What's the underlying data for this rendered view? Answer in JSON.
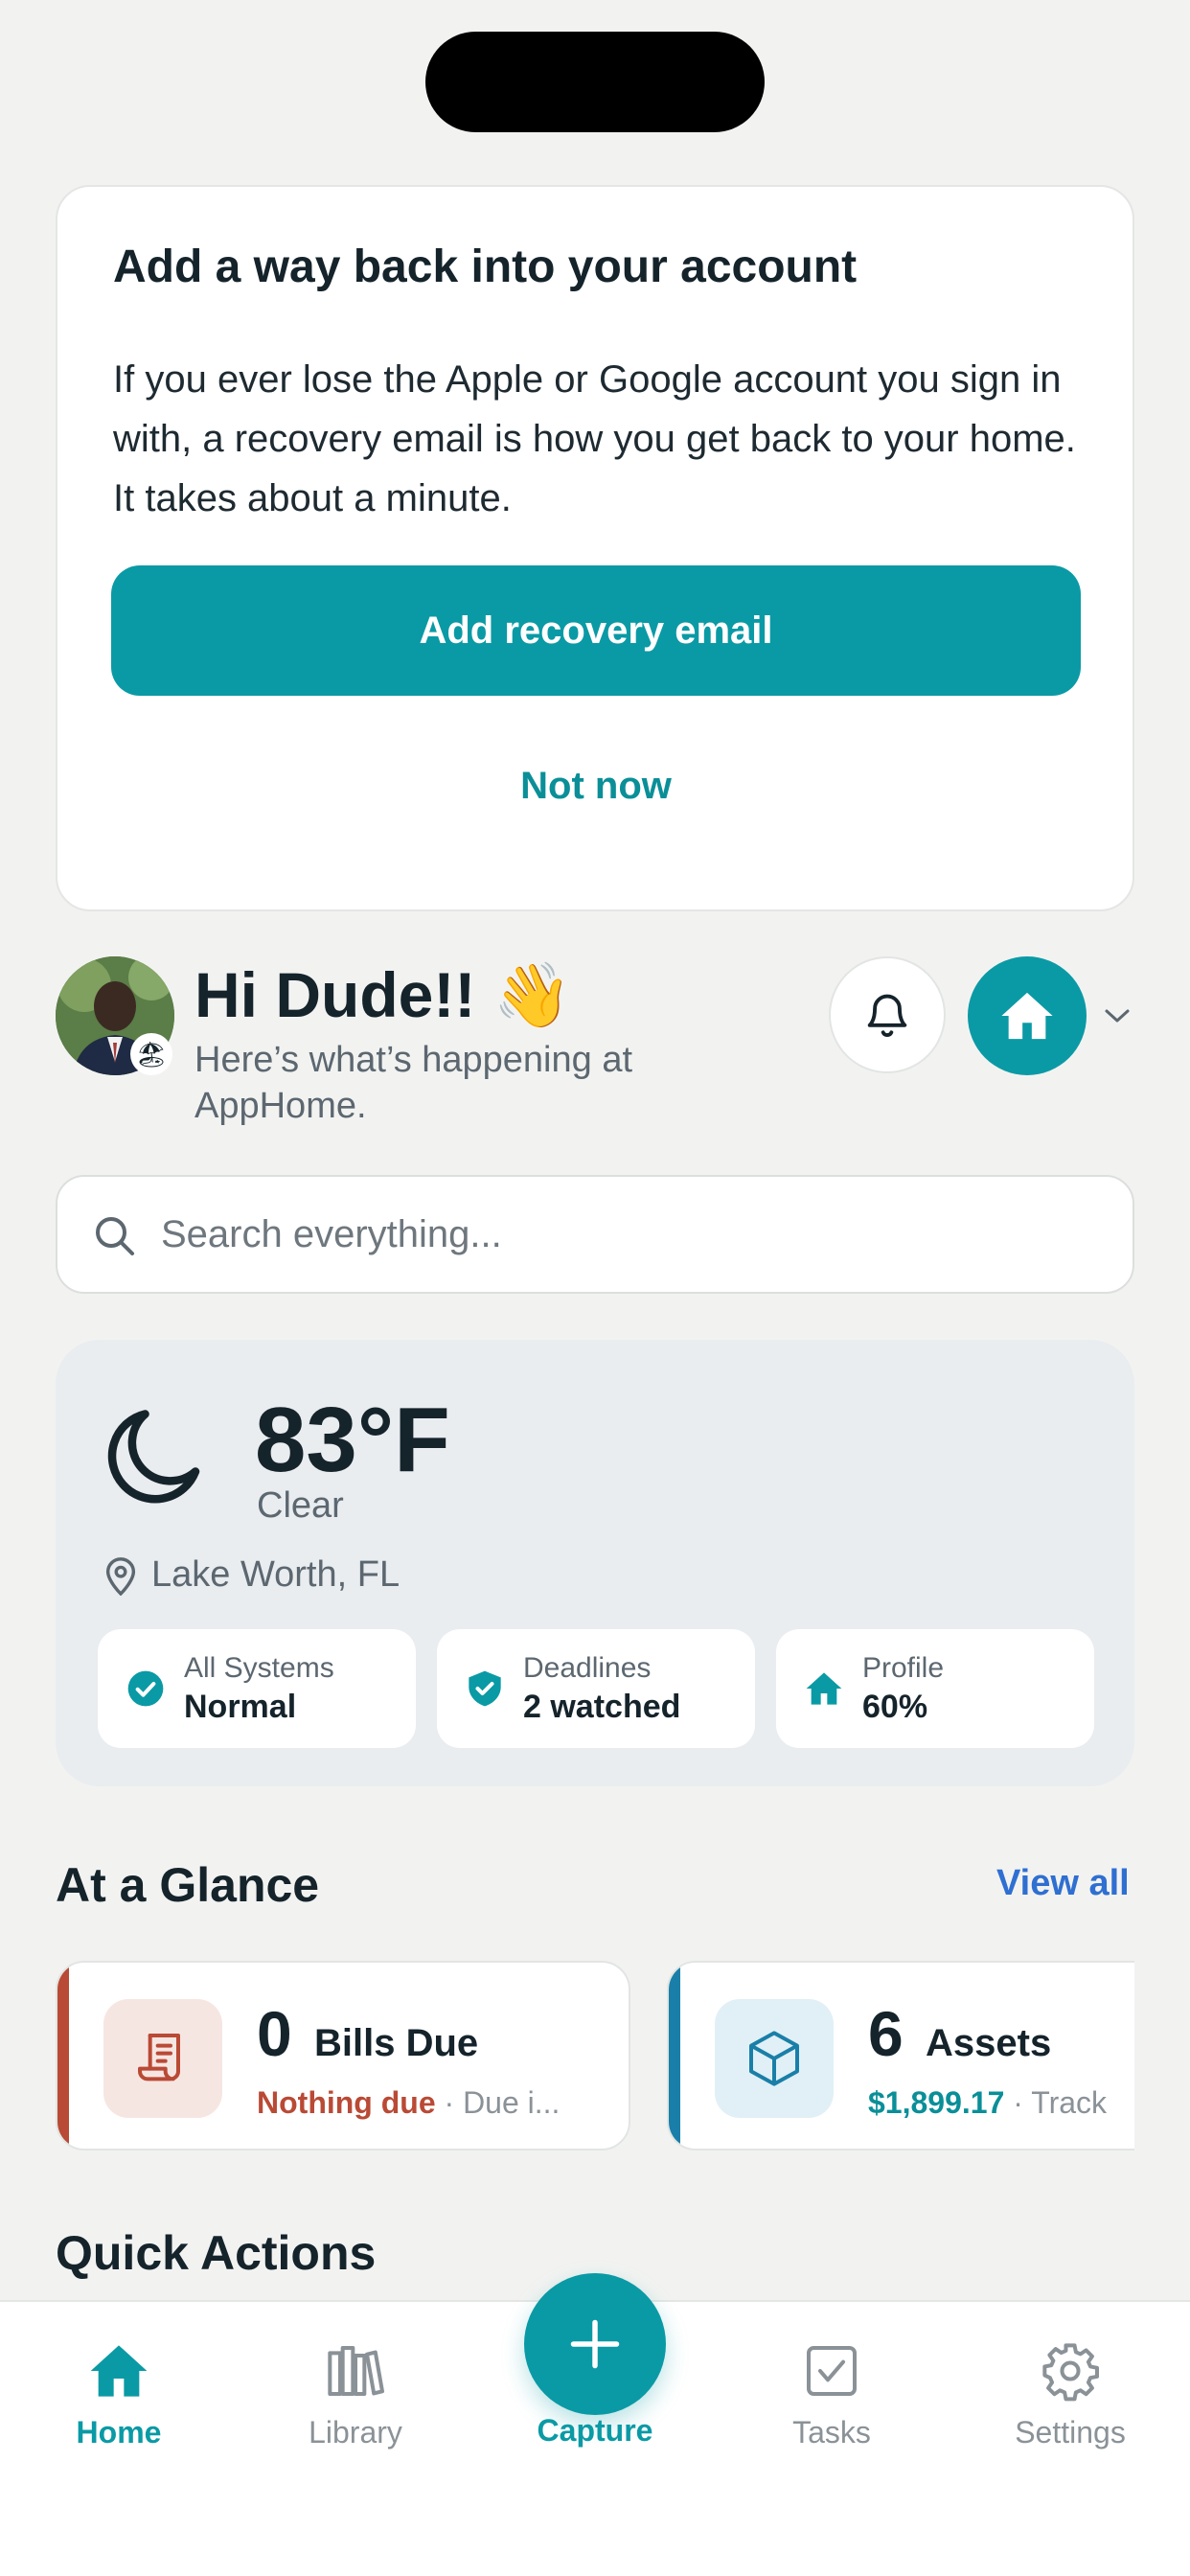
{
  "recovery_card": {
    "title": "Add a way back into your account",
    "body": "If you ever lose the Apple or Google account you sign in with, a recovery email is how you get back to your home. It takes about a minute.",
    "primary_label": "Add recovery email",
    "secondary_label": "Not now"
  },
  "header": {
    "greeting": "Hi Dude!! 👋",
    "subtitle": "Here’s what’s happening at AppHome.",
    "avatar_badge": "🏖"
  },
  "search": {
    "placeholder": "Search everything..."
  },
  "weather": {
    "temperature": "83°F",
    "condition": "Clear",
    "location": "Lake Worth, FL",
    "pills": [
      {
        "label": "All Systems",
        "value": "Normal",
        "icon": "check-circle-icon"
      },
      {
        "label": "Deadlines",
        "value": "2 watched",
        "icon": "shield-check-icon"
      },
      {
        "label": "Profile",
        "value": "60%",
        "icon": "home-icon"
      }
    ]
  },
  "glance": {
    "title": "At a Glance",
    "view_all": "View all",
    "cards": [
      {
        "count": "0",
        "label": "Bills Due",
        "status": "Nothing due",
        "detail": " · Due i...",
        "accent": "#b94a35",
        "icon": "receipt-icon"
      },
      {
        "count": "6",
        "label": "Assets",
        "status": "$1,899.17",
        "detail": " · Track",
        "accent": "#1a7fa8",
        "icon": "box-icon"
      }
    ]
  },
  "quick_actions": {
    "title": "Quick Actions"
  },
  "tabbar": {
    "home": "Home",
    "library": "Library",
    "capture": "Capture",
    "tasks": "Tasks",
    "settings": "Settings"
  },
  "colors": {
    "accent": "#0a9aa5",
    "link": "#2f6fd1",
    "bills_accent": "#b94a35",
    "assets_accent": "#1a7fa8"
  }
}
